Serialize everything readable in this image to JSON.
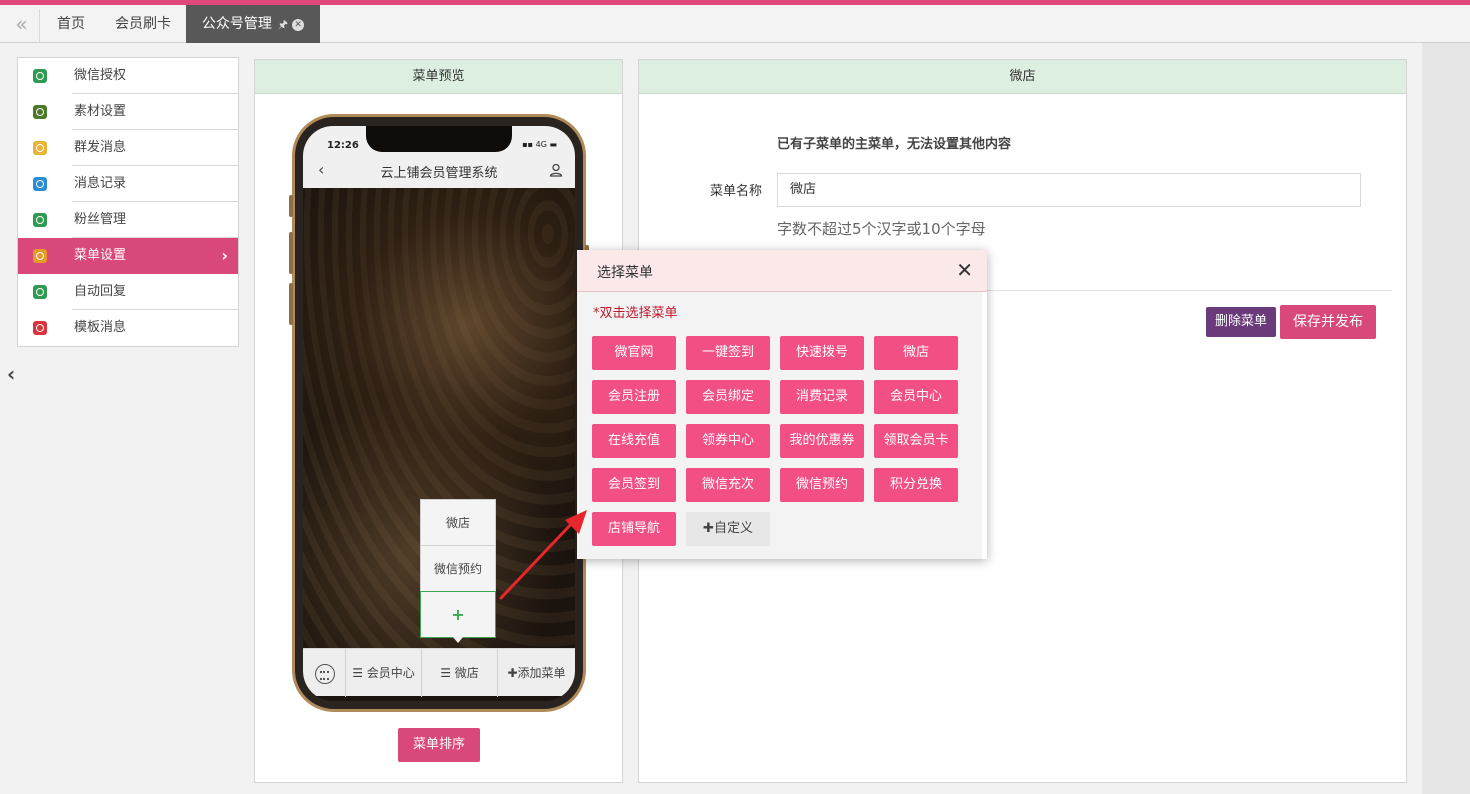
{
  "tabs": {
    "back_icon": "double-chevron-left-icon",
    "items": [
      {
        "label": "首页"
      },
      {
        "label": "会员刷卡"
      },
      {
        "label": "公众号管理",
        "pin": "🖈",
        "close": "✕"
      }
    ]
  },
  "sidebar": {
    "items": [
      {
        "label": "微信授权",
        "icon_color": "#2e9b53"
      },
      {
        "label": "素材设置",
        "icon_color": "#4d7a2a"
      },
      {
        "label": "群发消息",
        "icon_color": "#e6b437"
      },
      {
        "label": "消息记录",
        "icon_color": "#2a8fd0"
      },
      {
        "label": "粉丝管理",
        "icon_color": "#2e9b53"
      },
      {
        "label": "菜单设置",
        "icon_color": "#e79a2a",
        "active": true,
        "arrow": "›"
      },
      {
        "label": "自动回复",
        "icon_color": "#2e9b53"
      },
      {
        "label": "模板消息",
        "icon_color": "#d9343d"
      }
    ],
    "collapse_arrow": "‹"
  },
  "preview_panel": {
    "title": "菜单预览",
    "phone": {
      "time": "12:26",
      "status": "▪▪ 4G ▬",
      "back": "‹",
      "title": "云上铺会员管理系统",
      "bottom_menu": [
        "会员中心",
        "微店",
        "添加菜单"
      ],
      "menu_glyph": "☰",
      "add_glyph": "✚",
      "submenu": [
        "微店",
        "微信预约"
      ],
      "submenu_add": "+"
    },
    "sort_button": "菜单排序"
  },
  "detail_panel": {
    "title": "微店",
    "hint": "已有子菜单的主菜单，无法设置其他内容",
    "name_label": "菜单名称",
    "name_value": "微店",
    "name_tip": "字数不超过5个汉字或10个字母",
    "delete_button": "删除菜单",
    "save_button": "保存并发布"
  },
  "modal": {
    "title": "选择菜单",
    "close": "✕",
    "hint": "*双击选择菜单",
    "options": [
      "微官网",
      "一键签到",
      "快速拨号",
      "微店",
      "会员注册",
      "会员绑定",
      "消费记录",
      "会员中心",
      "在线充值",
      "领券中心",
      "我的优惠券",
      "领取会员卡",
      "会员签到",
      "微信充次",
      "微信预约",
      "积分兑换",
      "店铺导航"
    ],
    "custom_label": "自定义",
    "custom_glyph": "✚"
  },
  "colors": {
    "accent": "#d9487a",
    "option_pink": "#f24f85",
    "purple": "#6b3a7a",
    "green_head": "#dcefe0",
    "hint_red": "#c0182d"
  }
}
